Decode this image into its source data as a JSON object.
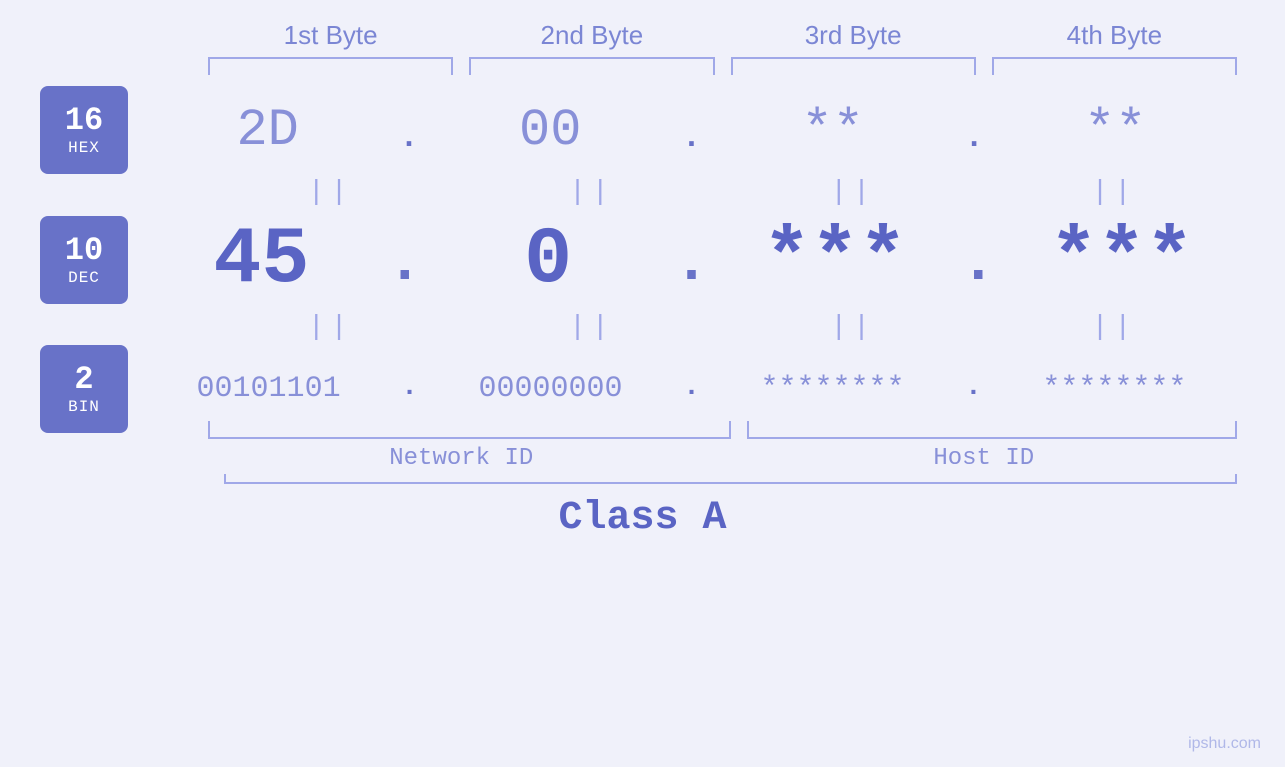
{
  "headers": {
    "byte1": "1st Byte",
    "byte2": "2nd Byte",
    "byte3": "3rd Byte",
    "byte4": "4th Byte"
  },
  "badges": {
    "hex": {
      "num": "16",
      "label": "HEX"
    },
    "dec": {
      "num": "10",
      "label": "DEC"
    },
    "bin": {
      "num": "2",
      "label": "BIN"
    }
  },
  "hex_values": {
    "b1": "2D",
    "b2": "00",
    "b3": "**",
    "b4": "**"
  },
  "dec_values": {
    "b1": "45",
    "b2": "0",
    "b3": "***",
    "b4": "***"
  },
  "bin_values": {
    "b1": "00101101",
    "b2": "00000000",
    "b3": "********",
    "b4": "********"
  },
  "labels": {
    "network_id": "Network ID",
    "host_id": "Host ID",
    "class": "Class A"
  },
  "watermark": "ipshu.com",
  "eq_symbol": "||"
}
